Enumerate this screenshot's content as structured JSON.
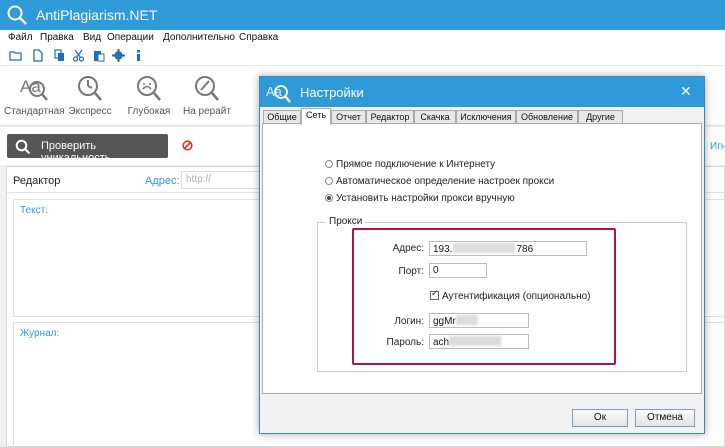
{
  "app": {
    "title": "AntiPlagiarism.NET"
  },
  "menu": [
    {
      "label": "Файл"
    },
    {
      "label": "Правка"
    },
    {
      "label": "Вид"
    },
    {
      "label": "Операции"
    },
    {
      "label": "Дополнительно"
    },
    {
      "label": "Справка"
    }
  ],
  "toolbar_icons": [
    "open-folder-icon",
    "new-file-icon",
    "copy-icon",
    "cut-icon",
    "paste-icon",
    "settings-gear-icon",
    "info-icon"
  ],
  "modes": [
    {
      "label": "Стандартная",
      "icon": "standard-mode-icon"
    },
    {
      "label": "Экспресс",
      "icon": "express-clock-icon"
    },
    {
      "label": "Глубокая",
      "icon": "deep-mode-icon"
    },
    {
      "label": "На рерайт",
      "icon": "rewrite-mode-icon"
    }
  ],
  "check": {
    "button_label": "Проверить уникальность",
    "ign_label": "Игн"
  },
  "editor": {
    "label": "Редактор",
    "address_label": "Адрес:",
    "address_placeholder": "http://",
    "text_label": "Текст:",
    "journal_label": "Журнал:"
  },
  "dialog": {
    "title": "Настройки",
    "tabs": [
      "Общие",
      "Сеть",
      "Отчет",
      "Редактор",
      "Скачка",
      "Исключения",
      "Обновление",
      "Другие"
    ],
    "active_tab": "Сеть",
    "radios": [
      {
        "label": "Прямое подключение к Интернету",
        "selected": false
      },
      {
        "label": "Автоматическое определение настроек прокси",
        "selected": false
      },
      {
        "label": "Установить настройки прокси вручную",
        "selected": true
      }
    ],
    "proxy": {
      "group_title": "Прокси",
      "address_label": "Адрес:",
      "address_prefix": "193.",
      "address_suffix": "786",
      "port_label": "Порт:",
      "port_value": "0",
      "auth_label": "Аутентификация (опционально)",
      "auth_checked": true,
      "login_label": "Логин:",
      "login_prefix": "ggMr",
      "password_label": "Пароль:",
      "password_prefix": "ach"
    },
    "ok_label": "Ок",
    "cancel_label": "Отмена"
  },
  "colors": {
    "accent": "#2e9ad8",
    "highlight": "#b0163c",
    "button_dark": "#555555"
  }
}
